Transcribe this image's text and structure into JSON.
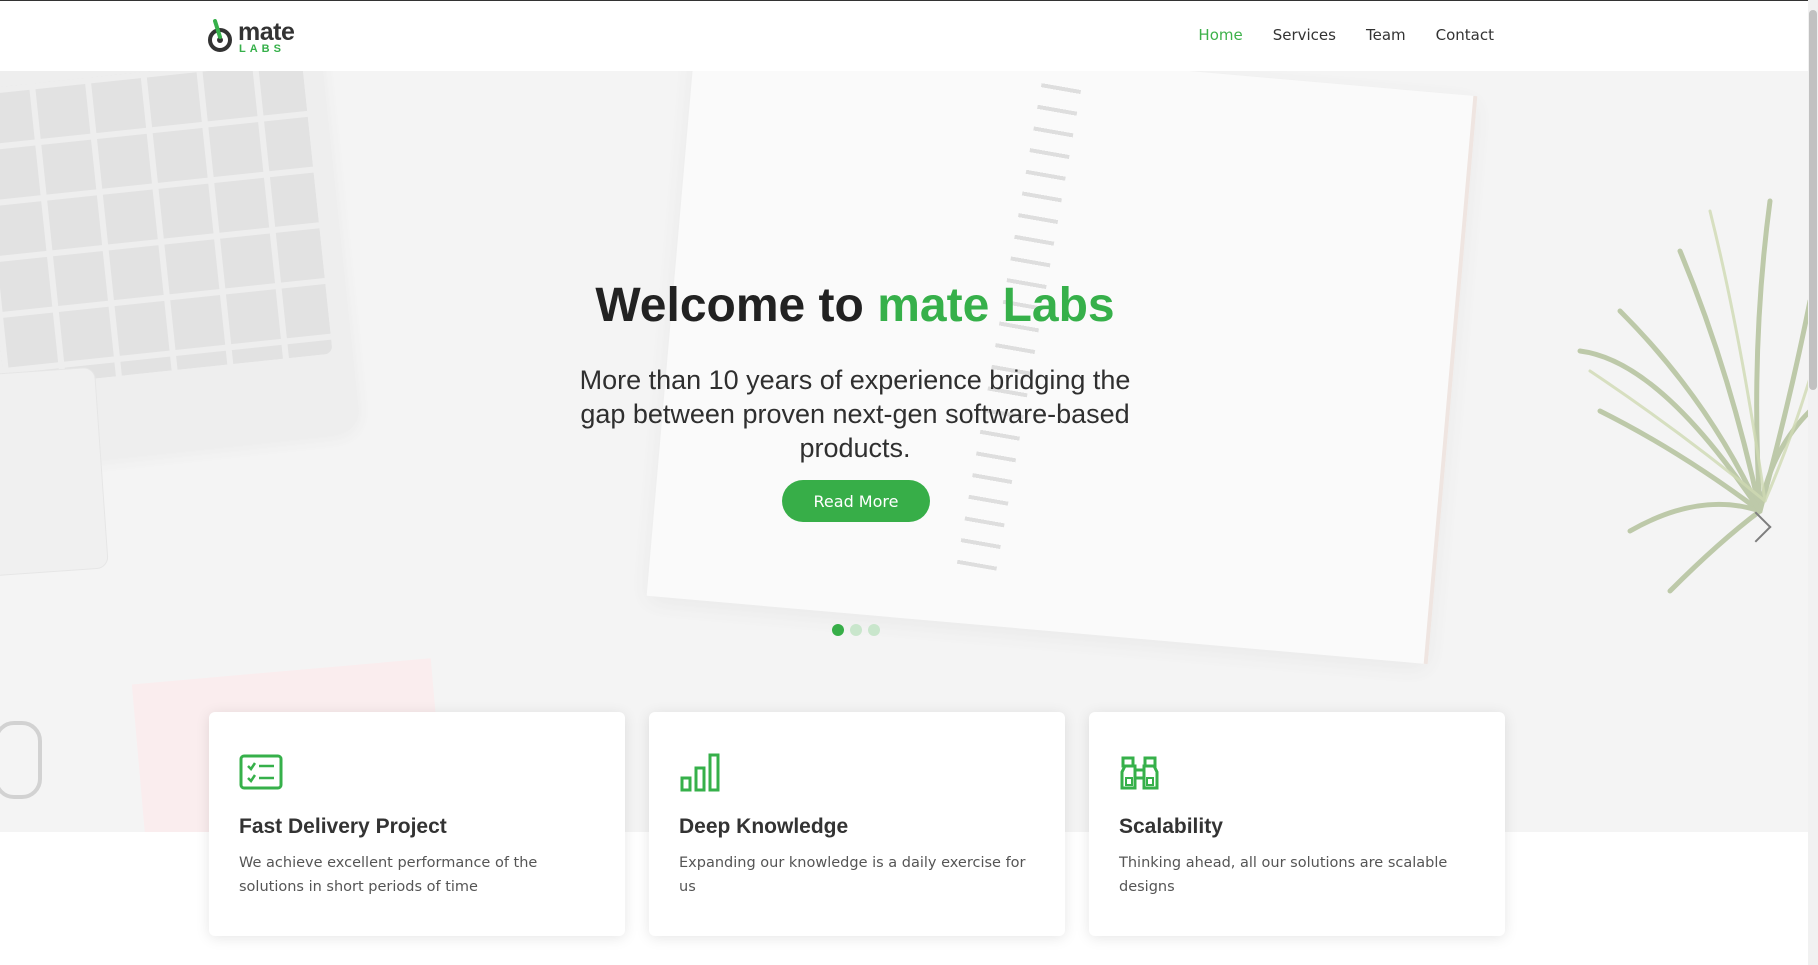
{
  "brand": {
    "name": "mate",
    "sub": "LABS",
    "accent": "#36b04a"
  },
  "nav": {
    "items": [
      {
        "label": "Home",
        "active": true
      },
      {
        "label": "Services",
        "active": false
      },
      {
        "label": "Team",
        "active": false
      },
      {
        "label": "Contact",
        "active": false
      }
    ]
  },
  "hero": {
    "title_prefix": "Welcome to",
    "title_accent": "mate Labs",
    "subtitle": "More than 10 years of experience bridging the gap between proven next-gen software-based products.",
    "cta_label": "Read More",
    "carousel": {
      "slides": 3,
      "active_index": 0
    }
  },
  "features": [
    {
      "icon": "checklist-icon",
      "title": "Fast Delivery Project",
      "description": "We achieve excellent performance of the solutions in short periods of time"
    },
    {
      "icon": "bar-chart-icon",
      "title": "Deep Knowledge",
      "description": "Expanding our knowledge is a daily exercise for us"
    },
    {
      "icon": "binoculars-icon",
      "title": "Scalability",
      "description": "Thinking ahead, all our solutions are scalable designs"
    }
  ]
}
